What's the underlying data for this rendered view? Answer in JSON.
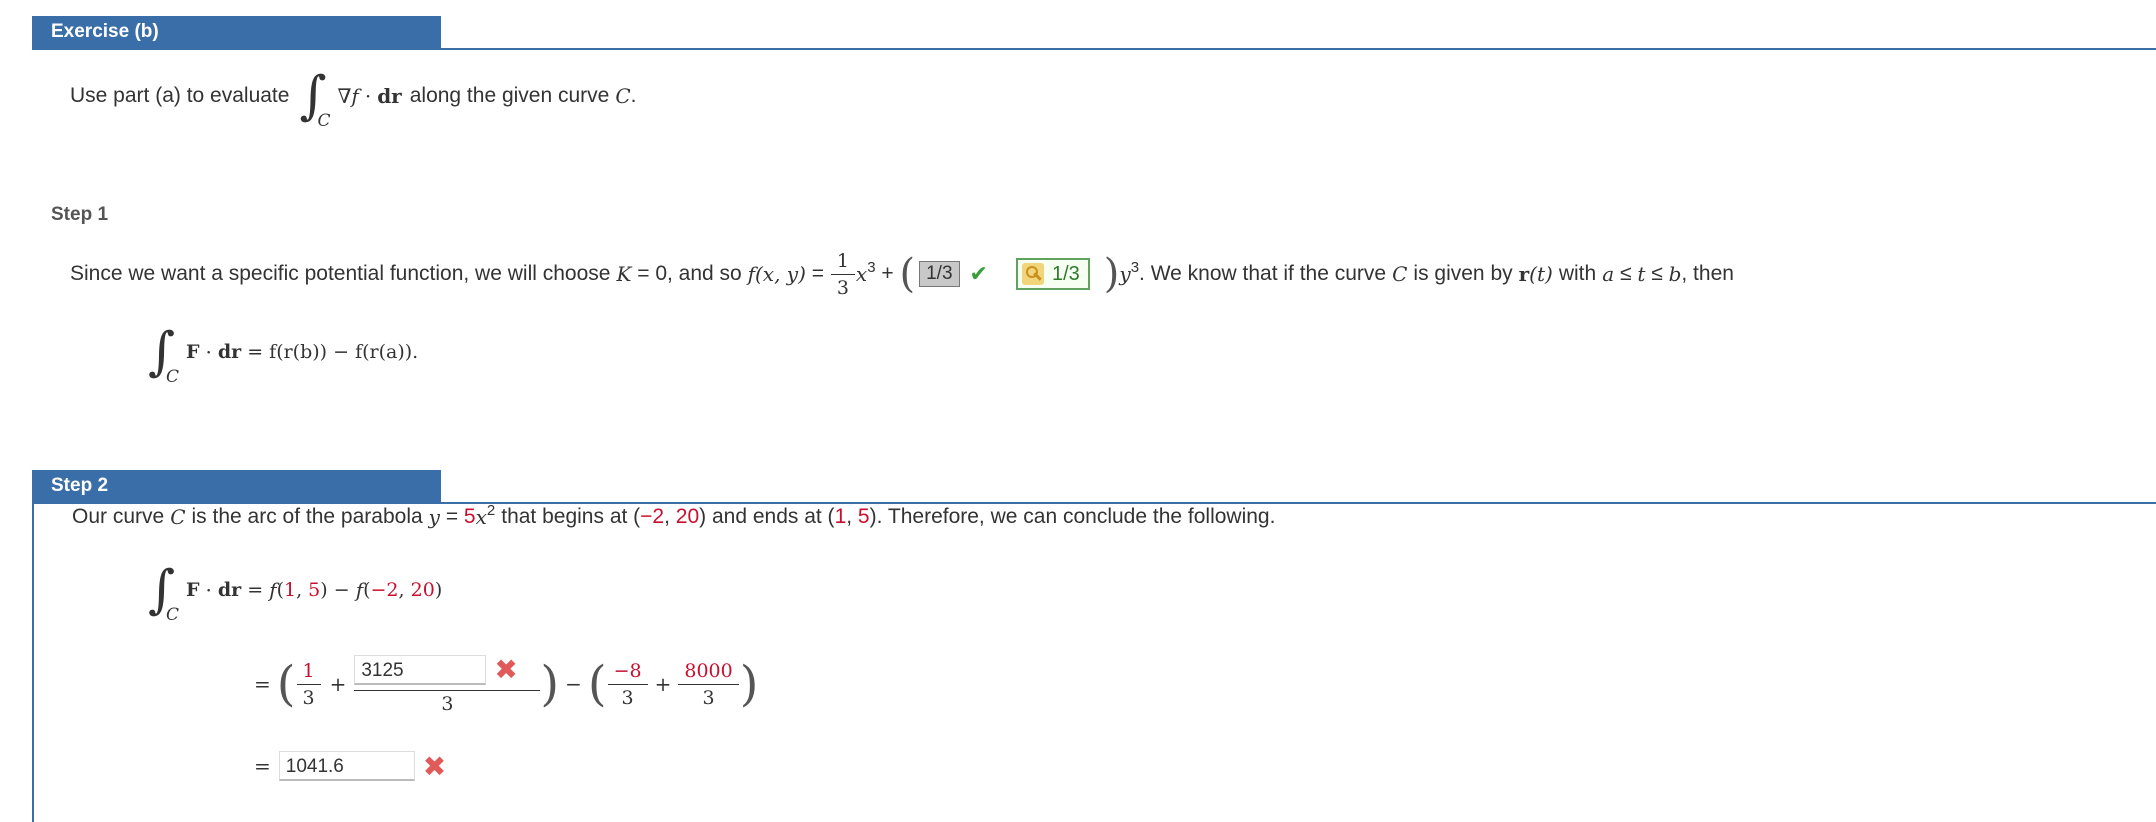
{
  "exercise": {
    "header": "Exercise (b)"
  },
  "intro": {
    "text_before": "Use part (a) to evaluate",
    "integral_sub": "C",
    "nabla_f": "∇f",
    "dot": "·",
    "dr": "dr",
    "text_after": "along the given curve",
    "curve": "C",
    "period": "."
  },
  "step1": {
    "label": "Step 1",
    "text1": "Since we want a specific potential function, we will choose",
    "K": "K",
    "eq_zero": " = 0, and so ",
    "fxy": "f(x, y)",
    "equals": " = ",
    "frac_num": "1",
    "frac_den": "3",
    "x3": "x",
    "exp3": "3",
    "plus": " + ",
    "answer_value": "1/3",
    "answer_check": "✔",
    "key_value": "1/3",
    "y3": "y",
    "y_exp": "3",
    "text2": ". We know that if the curve",
    "C": "C",
    "text3": "is given by",
    "r": "r",
    "t": "(t)",
    "text4": "with",
    "a": "a",
    "le1": " ≤ ",
    "t2": "t",
    "le2": " ≤ ",
    "b": "b",
    "text5": ", then",
    "ftc": {
      "integral_sub": "C",
      "F": "F",
      "dot": "·",
      "dr": "dr",
      "rhs": " = f(r(b)) − f(r(a))."
    }
  },
  "step2": {
    "label": "Step 2",
    "text1": "Our curve",
    "C": "C",
    "text2": "is the arc of the parabola",
    "y": "y",
    "eq": " = ",
    "coef": "5",
    "x": "x",
    "exp": "2",
    "text3": "that begins at (",
    "start_x": "−2",
    "comma1": ", ",
    "start_y": "20",
    "text4": ") and ends at (",
    "end_x": "1",
    "comma2": ", ",
    "end_y": "5",
    "text5": "). Therefore, we can conclude the following.",
    "eq1": {
      "integral_sub": "C",
      "F": "F",
      "dot": "·",
      "dr": "dr",
      "eq": " = ",
      "f": "f",
      "open": "(",
      "a1": "1",
      "sep1": ", ",
      "a2": "5",
      "close_minus": ") − ",
      "f2": "f",
      "open2": "(",
      "b1": "−2",
      "sep2": ", ",
      "b2": "20",
      "close2": ")"
    },
    "eq2": {
      "eq": "=",
      "frac1_num": "1",
      "frac1_den": "3",
      "plus1": "+",
      "input_value": "3125",
      "input_den": "3",
      "minus": "−",
      "frac2_num": "−8",
      "frac2_den": "3",
      "plus2": "+",
      "frac3_num": "8000",
      "frac3_den": "3"
    },
    "eq3": {
      "eq": "=",
      "input_value": "1041.6"
    }
  },
  "icons": {
    "wrong": "✖",
    "correct": "✔"
  },
  "colors": {
    "header_blue": "#3a6ea8",
    "red": "#c8102e",
    "green": "#3a9e3a",
    "wrong_red": "#e05a5a"
  }
}
